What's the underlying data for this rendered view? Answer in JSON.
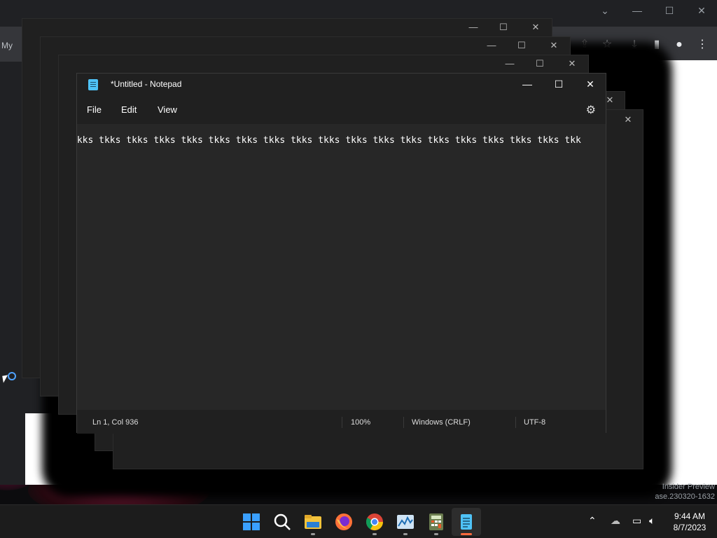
{
  "browser": {
    "sidebar_label": "My",
    "preview_lines": [
      "Insider Preview",
      "ase.230320-1632"
    ]
  },
  "notepad": {
    "title": "*Untitled - Notepad",
    "menu": {
      "file": "File",
      "edit": "Edit",
      "view": "View"
    },
    "content": "tkks tkks tkks tkks tkks tkks tkks tkks tkks tkks tkks tkks tkks tkks tkks tkks tkks tkks tkk",
    "status": {
      "position": "Ln 1, Col 936",
      "zoom": "100%",
      "line_ending": "Windows (CRLF)",
      "encoding": "UTF-8"
    }
  },
  "taskbar": {
    "apps": [
      "start-icon",
      "search-icon",
      "file-explorer-icon",
      "firefox-icon",
      "chrome-icon",
      "task-manager-icon",
      "calculator-icon",
      "notepad-icon"
    ],
    "clock": {
      "time": "9:44 AM",
      "date": "8/7/2023"
    }
  },
  "colors": {
    "accent": "#ff6a3d",
    "notepad_bg": "#272727",
    "taskbar_bg": "#1c1c1c"
  }
}
